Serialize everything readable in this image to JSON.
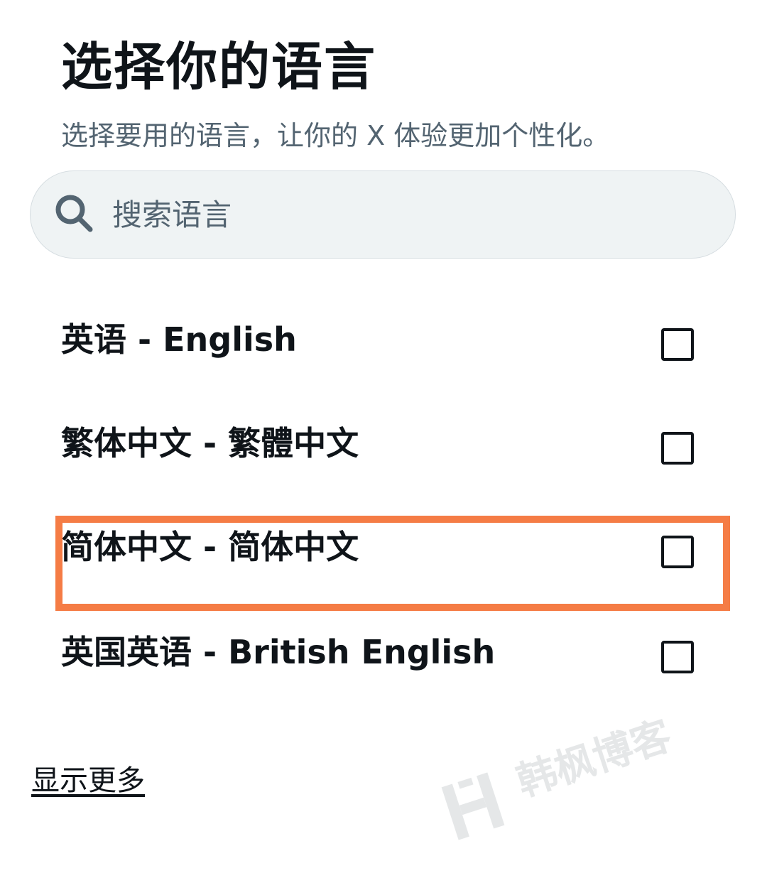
{
  "header": {
    "title": "选择你的语言",
    "subtitle": "选择要用的语言，让你的 X 体验更加个性化。"
  },
  "search": {
    "placeholder": "搜索语言",
    "icon": "search-icon"
  },
  "languages": [
    {
      "label": "英语 - English",
      "checked": false
    },
    {
      "label": "繁体中文 - 繁體中文",
      "checked": false
    },
    {
      "label": "简体中文 - 简体中文",
      "checked": false,
      "highlighted": true
    },
    {
      "label": "英国英语 - British English",
      "checked": false
    }
  ],
  "footer": {
    "show_more": "显示更多"
  },
  "watermark": {
    "text": "韩枫博客"
  },
  "colors": {
    "text": "#0f1419",
    "secondary_text": "#536471",
    "search_bg": "#eff3f4",
    "highlight": "#f57c45"
  }
}
